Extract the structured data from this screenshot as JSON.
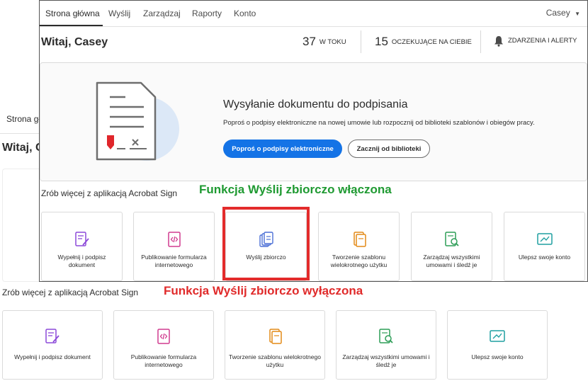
{
  "enabled": {
    "nav": {
      "tabs": [
        {
          "label": "Strona główna",
          "active": true
        },
        {
          "label": "Wyślij",
          "active": false
        },
        {
          "label": "Zarządzaj",
          "active": false
        },
        {
          "label": "Raporty",
          "active": false
        },
        {
          "label": "Konto",
          "active": false
        }
      ],
      "user": "Casey"
    },
    "greeting": "Witaj, Casey",
    "stats": [
      {
        "value": "37",
        "label": "W TOKU"
      },
      {
        "value": "15",
        "label": "OCZEKUJĄCE NA CIEBIE"
      }
    ],
    "alerts_label": "ZDARZENIA I ALERTY",
    "hero": {
      "title": "Wysyłanie dokumentu do podpisania",
      "description": "Poproś o podpisy elektroniczne na nowej umowie lub rozpocznij od biblioteki szablonów i obiegów pracy.",
      "primary_button": "Poproś o podpisy elektroniczne",
      "secondary_button": "Zacznij od biblioteki"
    },
    "section_title": "Zrób więcej z aplikacją Acrobat Sign",
    "cards": [
      {
        "label": "Wypełnij i podpisz dokument",
        "icon": "fill-sign-icon",
        "color": "#8c49d9"
      },
      {
        "label": "Publikowanie formularza internetowego",
        "icon": "web-form-icon",
        "color": "#d13b8f"
      },
      {
        "label": "Wyślij zbiorczo",
        "icon": "send-in-bulk-icon",
        "color": "#4b6fd6"
      },
      {
        "label": "Tworzenie szablonu wielokrotnego użytku",
        "icon": "reusable-template-icon",
        "color": "#e38a17"
      },
      {
        "label": "Zarządzaj wszystkimi umowami i śledź je",
        "icon": "manage-agreements-icon",
        "color": "#2d9d57"
      },
      {
        "label": "Ulepsz swoje konto",
        "icon": "upgrade-account-icon",
        "color": "#1e9fa0"
      }
    ]
  },
  "disabled": {
    "nav_partial": "Strona gł",
    "greeting_partial": "Witaj, C",
    "section_title": "Zrób więcej z aplikacją Acrobat Sign",
    "cards": [
      {
        "label": "Wypełnij i podpisz dokument",
        "icon": "fill-sign-icon",
        "color": "#8c49d9"
      },
      {
        "label": "Publikowanie formularza internetowego",
        "icon": "web-form-icon",
        "color": "#d13b8f"
      },
      {
        "label": "Tworzenie szablonu wielokrotnego użytku",
        "icon": "reusable-template-icon",
        "color": "#e38a17"
      },
      {
        "label": "Zarządzaj wszystkimi umowami i śledź je",
        "icon": "manage-agreements-icon",
        "color": "#2d9d57"
      },
      {
        "label": "Ulepsz swoje konto",
        "icon": "upgrade-account-icon",
        "color": "#1e9fa0"
      }
    ]
  },
  "annotations": {
    "enabled": "Funkcja Wyślij zbiorczo włączona",
    "disabled": "Funkcja Wyślij zbiorczo wyłączona"
  },
  "colors": {
    "accent": "#1473e6",
    "enabled_note": "#1f9a32",
    "disabled_note": "#e02a2a",
    "highlight": "#e32b2b"
  }
}
